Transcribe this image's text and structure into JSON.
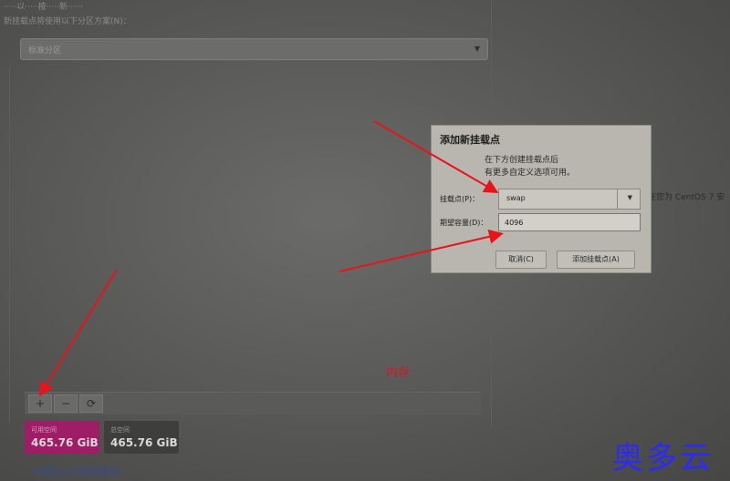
{
  "background": {
    "top_line": "·····以·····按·····新······",
    "scheme_label": "新挂载点将使用以下分区方案(N)：",
    "scheme_value": "标准分区"
  },
  "toolbar": {
    "add_label": "+",
    "remove_label": "−",
    "reload_label": "⟳"
  },
  "space": {
    "available_label": "可用空间",
    "available_value": "465.76 GiB",
    "total_label": "总空间",
    "total_value": "465.76 GiB"
  },
  "storage_link": "已选择 1 个存储设备(S)",
  "side_text": "在您为 CentOS 7 安",
  "memory_note": "内存",
  "watermark": "奥多云",
  "dialog": {
    "title": "添加新挂载点",
    "description_line1": "在下方创建挂载点后",
    "description_line2": "有更多自定义选项可用。",
    "mount_point_label": "挂载点(P)：",
    "mount_point_value": "swap",
    "capacity_label": "期望容量(D)：",
    "capacity_value": "4096",
    "cancel_label": "取消(C)",
    "add_label": "添加挂载点(A)"
  },
  "colors": {
    "annotation_red": "#e8141b",
    "available_magenta": "#9e1d66",
    "watermark_blue": "#2a2aff"
  }
}
